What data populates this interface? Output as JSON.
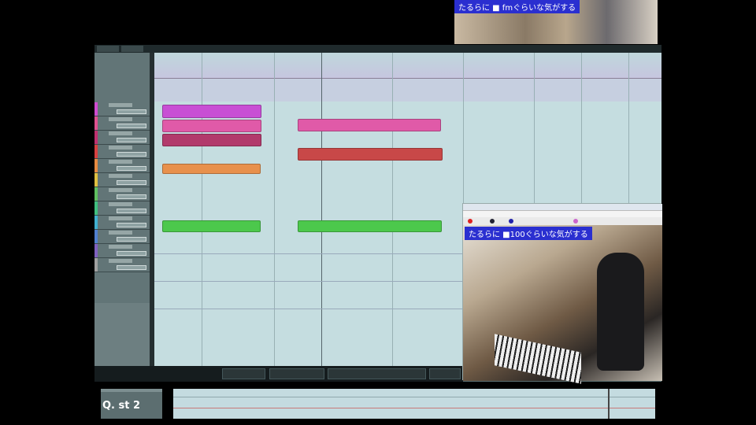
{
  "webcam_top": {
    "caption": "たるらに ■ fmぐらいな気がする"
  },
  "daw": {
    "toolbar": {
      "buttons": [
        "",
        ""
      ]
    },
    "tracks": [
      {
        "color": "#d04bd0"
      },
      {
        "color": "#e0508f"
      },
      {
        "color": "#c03070"
      },
      {
        "color": "#d84040"
      },
      {
        "color": "#e88a40"
      },
      {
        "color": "#e0c040"
      },
      {
        "color": "#60c060"
      },
      {
        "color": "#40c080"
      },
      {
        "color": "#40b0d0"
      },
      {
        "color": "#5080d0"
      },
      {
        "color": "#8060c0"
      },
      {
        "color": "#a0a0a0"
      }
    ],
    "clips": [
      {
        "track": "vocal-1",
        "color": "#c84fd4"
      },
      {
        "track": "vocal-2",
        "color": "#e05aa8"
      },
      {
        "track": "vocal-3",
        "color": "#b23a6c"
      },
      {
        "track": "vocal-2b",
        "color": "#e05aa8"
      },
      {
        "track": "bass",
        "color": "#c84848"
      },
      {
        "track": "keys",
        "color": "#e8904c"
      },
      {
        "track": "drums",
        "color": "#4cc84c"
      },
      {
        "track": "drums-b",
        "color": "#4cc84c"
      }
    ]
  },
  "webcam_window": {
    "caption": "たるらに ■100ぐらいな気がする"
  },
  "bottom_panel": {
    "label": "Q. st 2"
  }
}
